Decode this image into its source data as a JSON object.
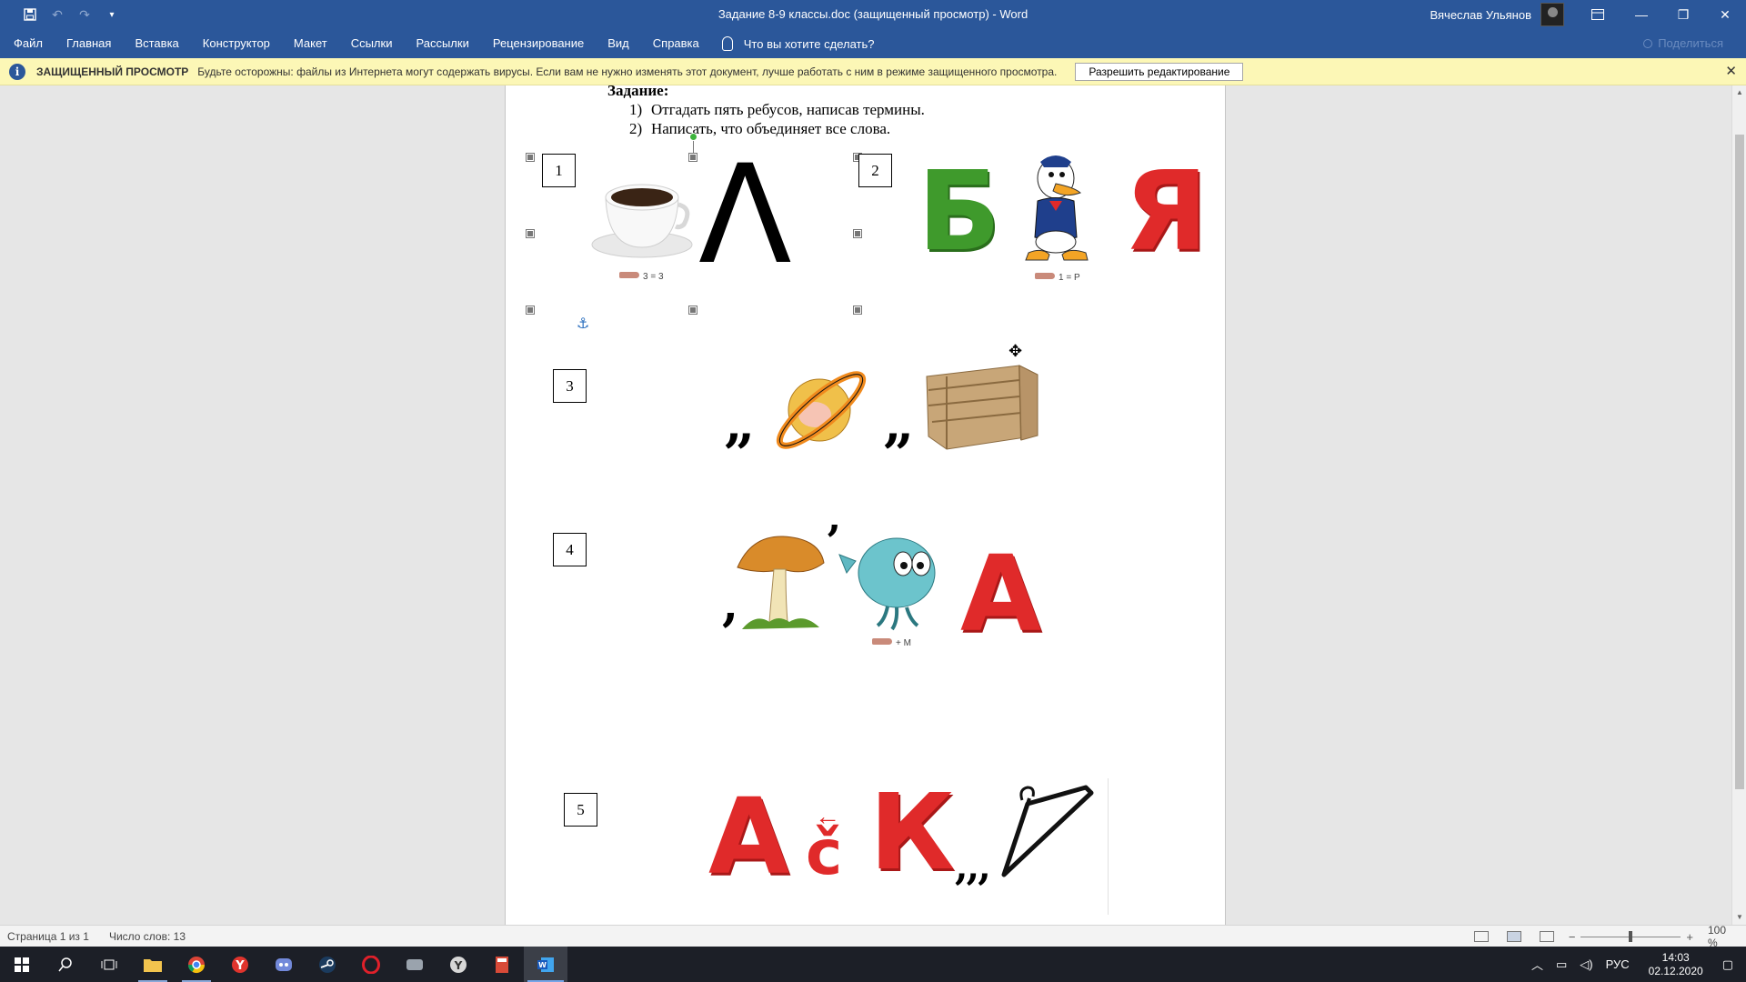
{
  "window": {
    "title": "Задание 8-9 классы.doc (защищенный просмотр)  -  Word",
    "user_name": "Вячеслав Ульянов",
    "qat_icons": [
      "save-icon",
      "undo-icon",
      "redo-icon",
      "customize-icon"
    ]
  },
  "menu": {
    "items": [
      "Файл",
      "Главная",
      "Вставка",
      "Конструктор",
      "Макет",
      "Ссылки",
      "Рассылки",
      "Рецензирование",
      "Вид",
      "Справка"
    ],
    "tell_me": "Что вы хотите сделать?",
    "share": "Поделиться"
  },
  "protected_view": {
    "title": "ЗАЩИЩЕННЫЙ ПРОСМОТР",
    "message": "Будьте осторожны: файлы из Интернета могут содержать вирусы. Если вам не нужно изменять этот документ, лучше работать с ним в режиме защищенного просмотра.",
    "button": "Разрешить редактирование"
  },
  "document": {
    "task_title": "Задание:",
    "tasks": [
      {
        "num": "1)",
        "text": "Отгадать пять ребусов, написав термины."
      },
      {
        "num": "2)",
        "text": "Написать, что объединяет все слова."
      }
    ],
    "rebuses": [
      {
        "number": "1",
        "letter": "Λ",
        "note": "3 = 3"
      },
      {
        "number": "2",
        "letters": [
          "Б",
          "Я"
        ],
        "note": "1 = Р"
      },
      {
        "number": "3",
        "commas_a": "„",
        "commas_b": "„"
      },
      {
        "number": "4",
        "comma_left": ",",
        "comma_mid": "’",
        "letter": "А",
        "note": "+ М"
      },
      {
        "number": "5",
        "letters": [
          "А",
          "č",
          "К"
        ],
        "commas": ",,,"
      }
    ]
  },
  "status": {
    "page": "Страница 1 из 1",
    "words": "Число слов: 13",
    "zoom": "100 %"
  },
  "taskbar": {
    "lang": "РУС",
    "time": "14:03",
    "date": "02.12.2020"
  },
  "colors": {
    "word_blue": "#2b579a",
    "protected_bar": "#fcf7b6",
    "plasticine_red": "#e02a2a",
    "plasticine_green": "#3f9a2c"
  }
}
